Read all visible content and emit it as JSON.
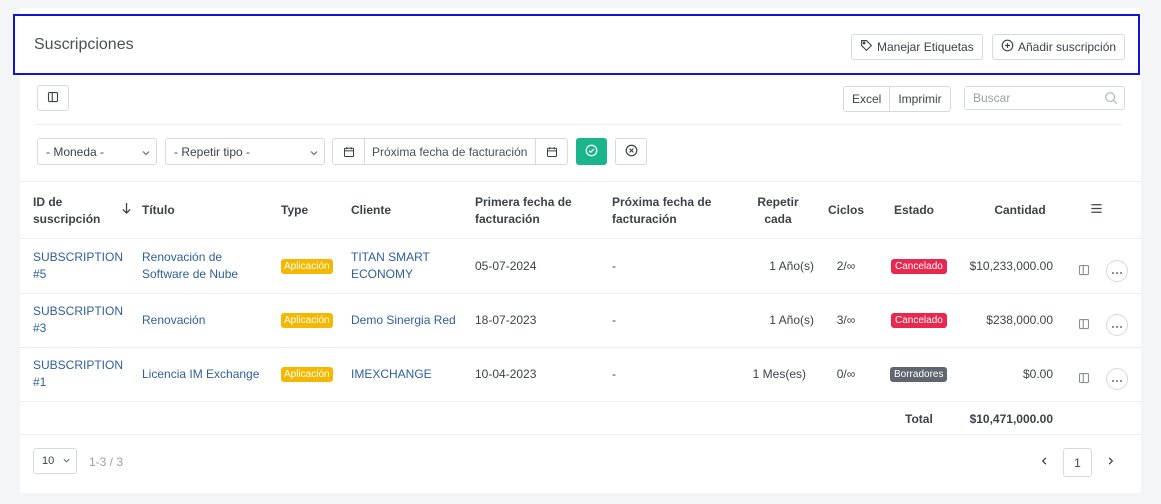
{
  "header": {
    "title": "Suscripciones",
    "manage_labels_btn": "Manejar Etiquetas",
    "add_subscription_btn": "Añadir suscripción"
  },
  "toolbar": {
    "excel": "Excel",
    "print": "Imprimir",
    "search_placeholder": "Buscar"
  },
  "filters": {
    "currency": "- Moneda -",
    "repeat_type": "- Repetir tipo -",
    "next_billing_date": "Próxima fecha de facturación"
  },
  "table": {
    "columns": {
      "id": "ID de suscripción",
      "title": "Título",
      "type": "Type",
      "client": "Cliente",
      "first_billing": "Primera fecha de facturación",
      "next_billing": "Próxima fecha de facturación",
      "repeat": "Repetir cada",
      "cycles": "Ciclos",
      "status": "Estado",
      "amount": "Cantidad"
    },
    "rows": [
      {
        "id": "SUBSCRIPTION #5",
        "title": "Renovación de Software de Nube",
        "type": "Aplicación",
        "client": "TITAN SMART ECONOMY",
        "first_billing": "05-07-2024",
        "next_billing": "-",
        "repeat": "1 Año(s)",
        "cycles": "2/∞",
        "status": "Cancelado",
        "status_color": "#e8284f",
        "amount": "$10,233,000.00"
      },
      {
        "id": "SUBSCRIPTION #3",
        "title": "Renovación",
        "type": "Aplicación",
        "client": "Demo Sinergia Red",
        "first_billing": "18-07-2023",
        "next_billing": "-",
        "repeat": "1 Año(s)",
        "cycles": "3/∞",
        "status": "Cancelado",
        "status_color": "#e8284f",
        "amount": "$238,000.00"
      },
      {
        "id": "SUBSCRIPTION #1",
        "title": "Licencia IM Exchange",
        "type": "Aplicación",
        "client": "IMEXCHANGE",
        "first_billing": "10-04-2023",
        "next_billing": "-",
        "repeat": "1 Mes(es)",
        "cycles": "0/∞",
        "status": "Borradores",
        "status_color": "#5f6670",
        "amount": "$0.00"
      }
    ],
    "total_label": "Total",
    "total_amount": "$10,471,000.00"
  },
  "footer": {
    "page_size": "10",
    "range": "1-3 / 3",
    "current_page": "1"
  },
  "colors": {
    "accent_green": "#1bb58c",
    "link": "#2e5f9e",
    "type_badge": "#f5b800",
    "highlight_border": "#1212d6"
  }
}
